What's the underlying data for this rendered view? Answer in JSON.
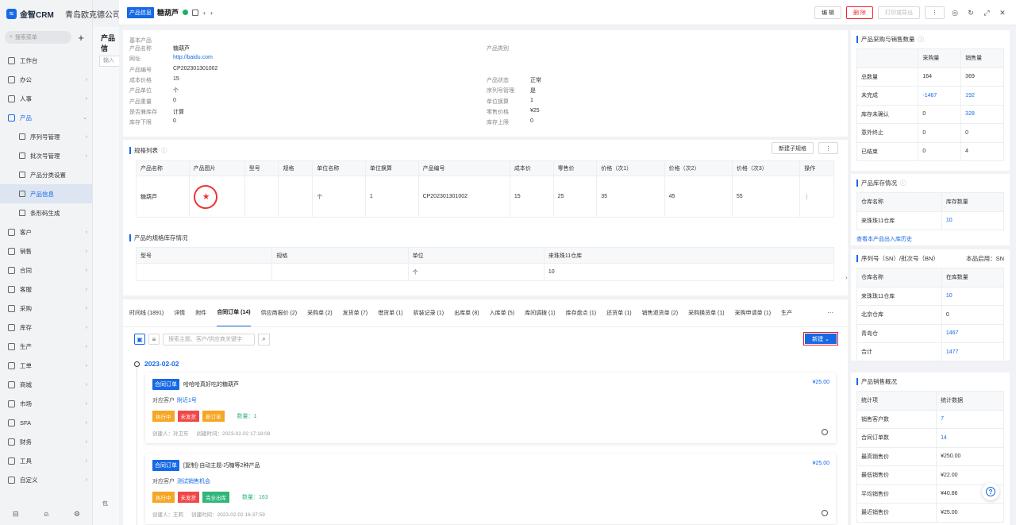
{
  "brand": {
    "name": "金智CRM",
    "company": "青岛欧克德公司"
  },
  "sidebar": {
    "search_placeholder": "搜索菜单",
    "items": [
      {
        "label": "工作台",
        "type": "item"
      },
      {
        "label": "办公",
        "type": "item",
        "arrow": true
      },
      {
        "label": "人事",
        "type": "item",
        "arrow": true
      },
      {
        "label": "产品",
        "type": "open",
        "arrow": true
      },
      {
        "label": "序列号管理",
        "type": "sub",
        "arrow": true
      },
      {
        "label": "批次号管理",
        "type": "sub",
        "arrow": true
      },
      {
        "label": "产品分类设置",
        "type": "sub"
      },
      {
        "label": "产品信息",
        "type": "sub-active"
      },
      {
        "label": "条形码生成",
        "type": "sub"
      },
      {
        "label": "客户",
        "type": "item",
        "arrow": true
      },
      {
        "label": "销售",
        "type": "item",
        "arrow": true
      },
      {
        "label": "合同",
        "type": "item",
        "arrow": true
      },
      {
        "label": "客服",
        "type": "item",
        "arrow": true
      },
      {
        "label": "采购",
        "type": "item",
        "arrow": true
      },
      {
        "label": "库存",
        "type": "item",
        "arrow": true
      },
      {
        "label": "生产",
        "type": "item",
        "arrow": true
      },
      {
        "label": "工单",
        "type": "item",
        "arrow": true
      },
      {
        "label": "商城",
        "type": "item",
        "arrow": true
      },
      {
        "label": "市场",
        "type": "item",
        "arrow": true
      },
      {
        "label": "SFA",
        "type": "item",
        "arrow": true
      },
      {
        "label": "财务",
        "type": "item",
        "arrow": true
      },
      {
        "label": "工具",
        "type": "item",
        "arrow": true
      },
      {
        "label": "自定义",
        "type": "item",
        "arrow": true
      }
    ]
  },
  "bgpage": {
    "title": "产品信",
    "input": "输入",
    "checkbox": "包"
  },
  "topbar": {
    "tag": "产品信息",
    "title": "糖葫芦",
    "edit": "编 辑",
    "delete": "删 除",
    "print": "打印或导出"
  },
  "basic": {
    "head": "基本产品",
    "left": [
      {
        "k": "产品名称",
        "v": "糖葫芦"
      },
      {
        "k": "网址",
        "v": "http://baidu.com",
        "link": true
      },
      {
        "k": "产品编号",
        "v": "CP202301301002"
      },
      {
        "k": "成本价格",
        "v": "15"
      },
      {
        "k": "产品单位",
        "v": "个"
      },
      {
        "k": "产品重量",
        "v": "0"
      },
      {
        "k": "是否兼库存",
        "v": "计算"
      },
      {
        "k": "库存下限",
        "v": "0"
      }
    ],
    "right": [
      {
        "k": "产品类别",
        "v": ""
      },
      {
        "k": "产品状态",
        "v": "正常"
      },
      {
        "k": "序列号管理",
        "v": "是"
      },
      {
        "k": "单位换算",
        "v": "1"
      },
      {
        "k": "零售价格",
        "v": "¥25"
      },
      {
        "k": "库存上限",
        "v": "0"
      }
    ]
  },
  "spec": {
    "title": "规格列表",
    "new_btn": "新建子规格",
    "headers": [
      "产品名称",
      "产品图片",
      "型号",
      "规格",
      "单位名称",
      "单位换算",
      "产品编号",
      "成本价",
      "零售价",
      "价格（次1）",
      "价格（次2）",
      "价格（次3）",
      "操作"
    ],
    "row": [
      "糖葫芦",
      "",
      "",
      "",
      "个",
      "1",
      "CP202301301002",
      "15",
      "25",
      "35",
      "45",
      "55",
      "⋮"
    ],
    "stock_title": "产品的规格库存情况",
    "stock_headers": [
      "型号",
      "规格",
      "单位",
      "来珠珠11仓库"
    ],
    "stock_row": [
      "",
      "",
      "个",
      "10"
    ]
  },
  "tabs": [
    "时间线 (1891)",
    "详情",
    "附件",
    "合同订单 (14)",
    "供应商报价 (2)",
    "采购单 (2)",
    "发货单 (7)",
    "借货单 (1)",
    "拆装记录 (1)",
    "出库单 (8)",
    "入库单 (5)",
    "库间调拨 (1)",
    "库存盘点 (1)",
    "还货单 (1)",
    "销售退货单 (2)",
    "采购换货单 (1)",
    "采购申请单 (1)",
    "生产"
  ],
  "active_tab": 3,
  "toolbar": {
    "search_placeholder": "搜索主题、客户/供应商关键字",
    "new_btn": "新建"
  },
  "timeline": {
    "date": "2023-02-02",
    "orders": [
      {
        "tag": "合同订单",
        "title": "哈哈哈真好吃的糖葫芦",
        "price": "¥25.00",
        "cust_label": "对应客户",
        "cust": "附近1号",
        "chips": [
          {
            "t": "执行中",
            "c": "orange"
          },
          {
            "t": "未发货",
            "c": "red"
          },
          {
            "t": "新订单",
            "c": "orange"
          }
        ],
        "qty": "数量：1",
        "creator": "创建人：孙卫东",
        "time": "创建时间：2023-02-02 17:18:08"
      },
      {
        "tag": "合同订单",
        "title": "[复制]-自动主题-巧糖等2种产品",
        "price": "¥25.00",
        "cust_label": "对应客户",
        "cust": "测试销售机会",
        "chips": [
          {
            "t": "执行中",
            "c": "orange"
          },
          {
            "t": "未发货",
            "c": "red"
          },
          {
            "t": "完全出库",
            "c": "green"
          }
        ],
        "qty": "数量：163",
        "creator": "创建人：王莉",
        "time": "创建时间：2023-02-02 16:37:59"
      }
    ]
  },
  "right": {
    "purchase": {
      "title": "产品采购与销售数量",
      "headers": [
        "",
        "采购量",
        "销售量"
      ],
      "rows": [
        [
          "总数量",
          "164",
          "369"
        ],
        [
          "未完成",
          "-1467",
          "192"
        ],
        [
          "库存未确认",
          "0",
          "328"
        ],
        [
          "意外终止",
          "0",
          "0"
        ],
        [
          "已结束",
          "0",
          "4"
        ]
      ]
    },
    "stock": {
      "title": "产品库存情况",
      "headers": [
        "仓库名称",
        "库存数量"
      ],
      "rows": [
        [
          "来珠珠11仓库",
          "10"
        ]
      ],
      "link": "查看本产品出入库历史"
    },
    "serial": {
      "title": "序列号（SN）/批次号（BN）",
      "enabled": "本品启用：SN",
      "headers": [
        "仓库名称",
        "在库数量"
      ],
      "rows": [
        [
          "来珠珠11仓库",
          "10"
        ],
        [
          "北京仓库",
          "0"
        ],
        [
          "青岛仓",
          "1467"
        ],
        [
          "合计",
          "1477"
        ]
      ]
    },
    "sales": {
      "title": "产品销售概况",
      "headers": [
        "统计项",
        "统计数据"
      ],
      "rows": [
        [
          "销售客户数",
          "7"
        ],
        [
          "合同订单数",
          "14"
        ],
        [
          "最高销售价",
          "¥250.00"
        ],
        [
          "最低销售价",
          "¥22.00"
        ],
        [
          "平均销售价",
          "¥40.86"
        ],
        [
          "最近销售价",
          "¥25.00"
        ]
      ]
    }
  }
}
